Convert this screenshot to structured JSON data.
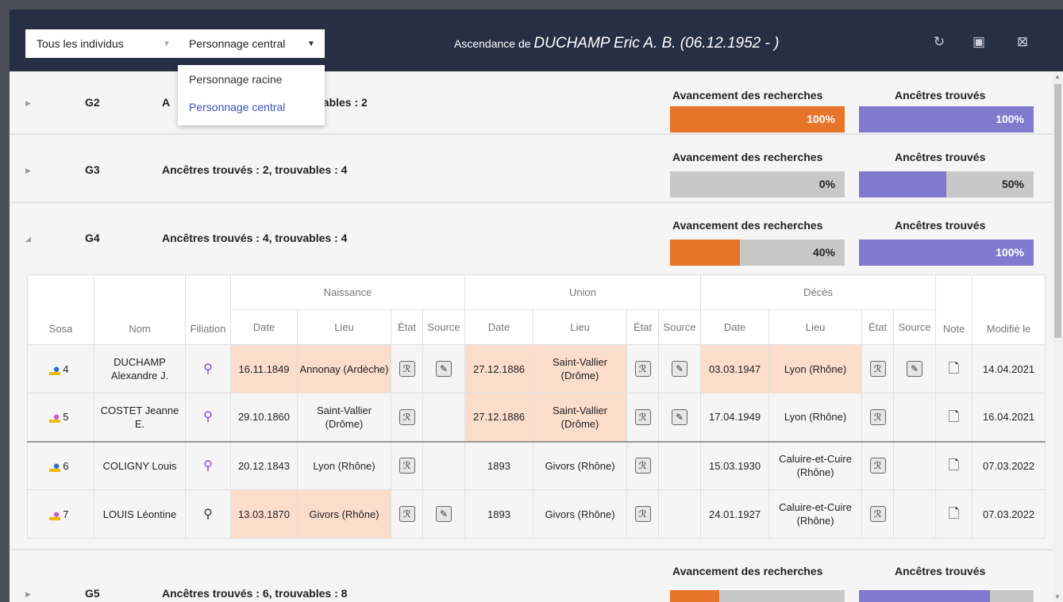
{
  "toolbar": {
    "filter_label": "Tous les individus",
    "center_label": "Personnage central",
    "title_prefix": "Ascendance de ",
    "title_name": "DUCHAMP Eric A. B. (06.12.1952 - )",
    "icons": [
      "refresh-icon",
      "pdf-icon",
      "excel-icon"
    ]
  },
  "menu": {
    "items": [
      "Personnage racine",
      "Personnage central"
    ],
    "selected": "Personnage central"
  },
  "labels": {
    "progress": "Avancement des recherches",
    "found": "Ancêtres trouvés"
  },
  "colors": {
    "orange": "#e8742a",
    "purple": "#8179cd",
    "peach": "#fcdccb",
    "header": "#272f45"
  },
  "generations": [
    {
      "name": "G2",
      "stat_visible": "vables : 2",
      "progress": 100,
      "progress_label": "100%",
      "found": 100,
      "found_label": "100%"
    },
    {
      "name": "G3",
      "stat": "Ancêtres trouvés : 2, trouvables : 4",
      "progress": 0,
      "progress_label": "0%",
      "found": 50,
      "found_label": "50%"
    },
    {
      "name": "G4",
      "stat": "Ancêtres trouvés : 4, trouvables : 4",
      "progress": 40,
      "progress_label": "40%",
      "found": 100,
      "found_label": "100%"
    },
    {
      "name": "G5",
      "stat": "Ancêtres trouvés : 6, trouvables : 8",
      "progress": 28,
      "found": 75
    }
  ],
  "g2_partial_prefix": "A",
  "table": {
    "group_headers": [
      "Naissance",
      "Union",
      "Décès"
    ],
    "headers": [
      "Sosa",
      "Nom",
      "Filiation",
      "Date",
      "Lieu",
      "État",
      "Source",
      "Date",
      "Lieu",
      "État",
      "Source",
      "Date",
      "Lieu",
      "État",
      "Source",
      "Note",
      "Modifié le"
    ],
    "rows": [
      {
        "sosa": "4",
        "sex": "m",
        "nom": "DUCHAMP Alexandre J.",
        "b_date": "16.11.1849",
        "b_lieu": "Annonay (Ardèche)",
        "b_source": true,
        "u_date": "27.12.1886",
        "u_lieu": "Saint-Vallier (Drôme)",
        "u_source": true,
        "d_date": "03.03.1947",
        "d_lieu": "Lyon (Rhône)",
        "d_source": true,
        "modif": "14.04.2021",
        "peach": [
          "b_date",
          "b_lieu",
          "u_date",
          "u_lieu",
          "d_date",
          "d_lieu"
        ]
      },
      {
        "sosa": "5",
        "sex": "f",
        "nom": "COSTET Jeanne E.",
        "b_date": "29.10.1860",
        "b_lieu": "Saint-Vallier (Drôme)",
        "b_source": false,
        "u_date": "27.12.1886",
        "u_lieu": "Saint-Vallier (Drôme)",
        "u_source": true,
        "d_date": "17.04.1949",
        "d_lieu": "Lyon (Rhône)",
        "d_source": false,
        "modif": "16.04.2021",
        "peach": [
          "u_date",
          "u_lieu"
        ]
      },
      {
        "sosa": "6",
        "sex": "m",
        "nom": "COLIGNY Louis",
        "b_date": "20.12.1843",
        "b_lieu": "Lyon (Rhône)",
        "b_source": false,
        "u_date": "1893",
        "u_lieu": "Givors (Rhône)",
        "u_source": false,
        "d_date": "15.03.1930",
        "d_lieu": "Caluire-et-Cuire (Rhône)",
        "d_source": false,
        "modif": "07.03.2022",
        "peach": []
      },
      {
        "sosa": "7",
        "sex": "f",
        "nom": "LOUIS Léontine",
        "b_date": "13.03.1870",
        "b_lieu": "Givors (Rhône)",
        "b_source": true,
        "u_date": "1893",
        "u_lieu": "Givors (Rhône)",
        "u_source": false,
        "d_date": "24.01.1927",
        "d_lieu": "Caluire-et-Cuire (Rhône)",
        "d_source": false,
        "modif": "07.03.2022",
        "peach": [
          "b_date",
          "b_lieu"
        ]
      }
    ]
  }
}
